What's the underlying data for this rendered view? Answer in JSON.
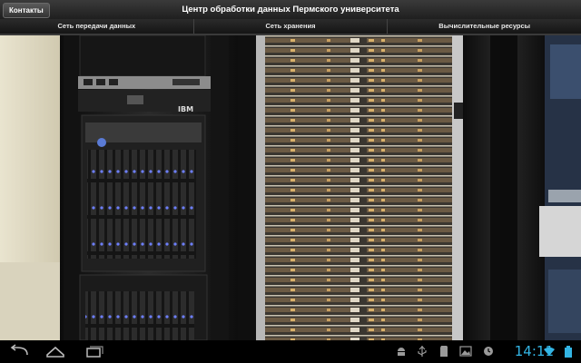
{
  "header": {
    "contacts_button": "Контакты",
    "title": "Центр обработки данных Пермского университета"
  },
  "tabs": [
    {
      "label": "Сеть передачи данных"
    },
    {
      "label": "Сеть хранения"
    },
    {
      "label": "Вычислительные ресурсы"
    }
  ],
  "photo": {
    "server_brand": "IBM"
  },
  "statusbar": {
    "time": "14:11",
    "accent_color": "#33b5e5",
    "icons": [
      "back-icon",
      "home-icon",
      "recent-apps-icon",
      "android-icon",
      "usb-icon",
      "sd-card-icon",
      "image-icon",
      "alarm-icon",
      "wifi-icon",
      "battery-icon"
    ]
  }
}
